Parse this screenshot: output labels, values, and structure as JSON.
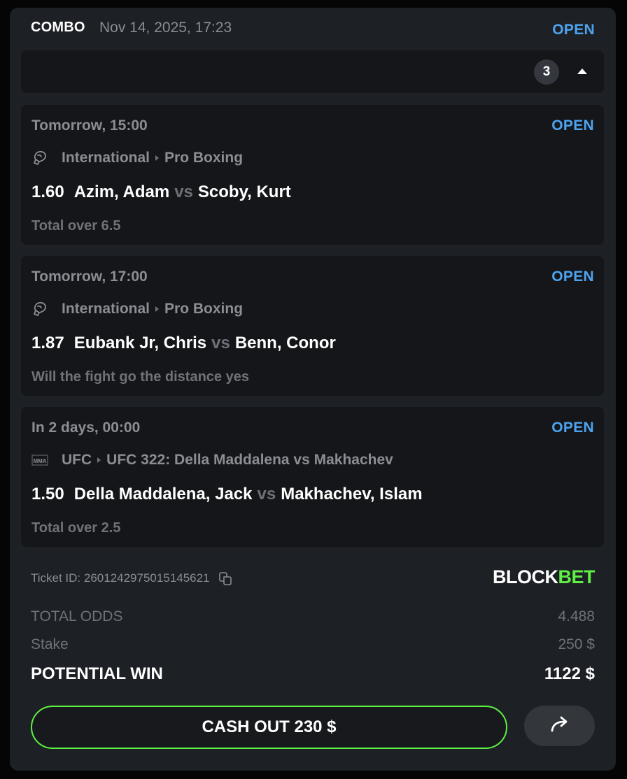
{
  "header": {
    "type": "COMBO",
    "date": "Nov 14, 2025, 17:23",
    "status": "OPEN"
  },
  "collapse": {
    "count": "3",
    "icon": "caret-up-icon"
  },
  "legs": [
    {
      "time": "Tomorrow, 15:00",
      "status": "OPEN",
      "sport_icon": "boxing-glove-icon",
      "category": "International",
      "league": "Pro Boxing",
      "odds": "1.60",
      "home": "Azim, Adam",
      "vs": "vs",
      "away": "Scoby, Kurt",
      "market": "Total over 6.5"
    },
    {
      "time": "Tomorrow, 17:00",
      "status": "OPEN",
      "sport_icon": "boxing-glove-icon",
      "category": "International",
      "league": "Pro Boxing",
      "odds": "1.87",
      "home": "Eubank Jr, Chris",
      "vs": "vs",
      "away": "Benn, Conor",
      "market": "Will the fight go the distance yes"
    },
    {
      "time": "In 2 days, 00:00",
      "status": "OPEN",
      "sport_icon": "mma-icon",
      "sport_icon_text": "MMA",
      "category": "UFC",
      "league": "UFC 322: Della Maddalena vs Makhachev",
      "odds": "1.50",
      "home": "Della Maddalena, Jack",
      "vs": "vs",
      "away": "Makhachev, Islam",
      "market": "Total over 2.5"
    }
  ],
  "ticket": {
    "id_label": "Ticket ID: 2601242975015145621",
    "brand_part1": "BLOCK",
    "brand_part2": "BET"
  },
  "summary": {
    "total_odds_label": "TOTAL ODDS",
    "total_odds": "4.488",
    "stake_label": "Stake",
    "stake": "250 $",
    "win_label": "POTENTIAL WIN",
    "win": "1122 $"
  },
  "actions": {
    "cashout_label": "CASH OUT 230 $",
    "share_icon": "share-arrow-icon"
  },
  "colors": {
    "accent_green": "#5ef043",
    "status_blue": "#4da3f0",
    "card_bg": "#1d2024",
    "leg_bg": "#141619"
  }
}
